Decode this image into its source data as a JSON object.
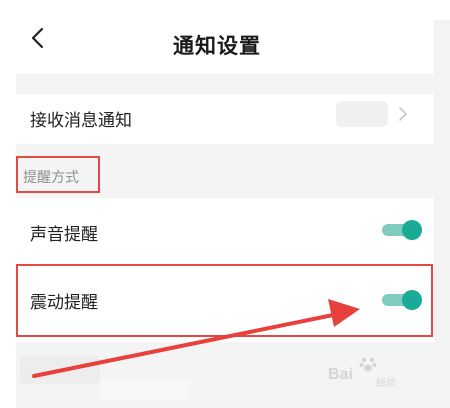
{
  "header": {
    "title": "通知设置",
    "back_icon": "chevron-left-icon"
  },
  "rows": {
    "receive": {
      "label": "接收消息通知",
      "icon": "chevron-right-icon"
    },
    "section_label": "提醒方式",
    "sound": {
      "label": "声音提醒",
      "enabled": true
    },
    "vibrate": {
      "label": "震动提醒",
      "enabled": true
    }
  },
  "colors": {
    "accent": "#1aab97",
    "accent_track": "#7fcbc0",
    "annotation": "#e24a46"
  },
  "watermark": {
    "text": "Bai",
    "sub": "经验",
    "icon": "baidu-paw-icon"
  }
}
